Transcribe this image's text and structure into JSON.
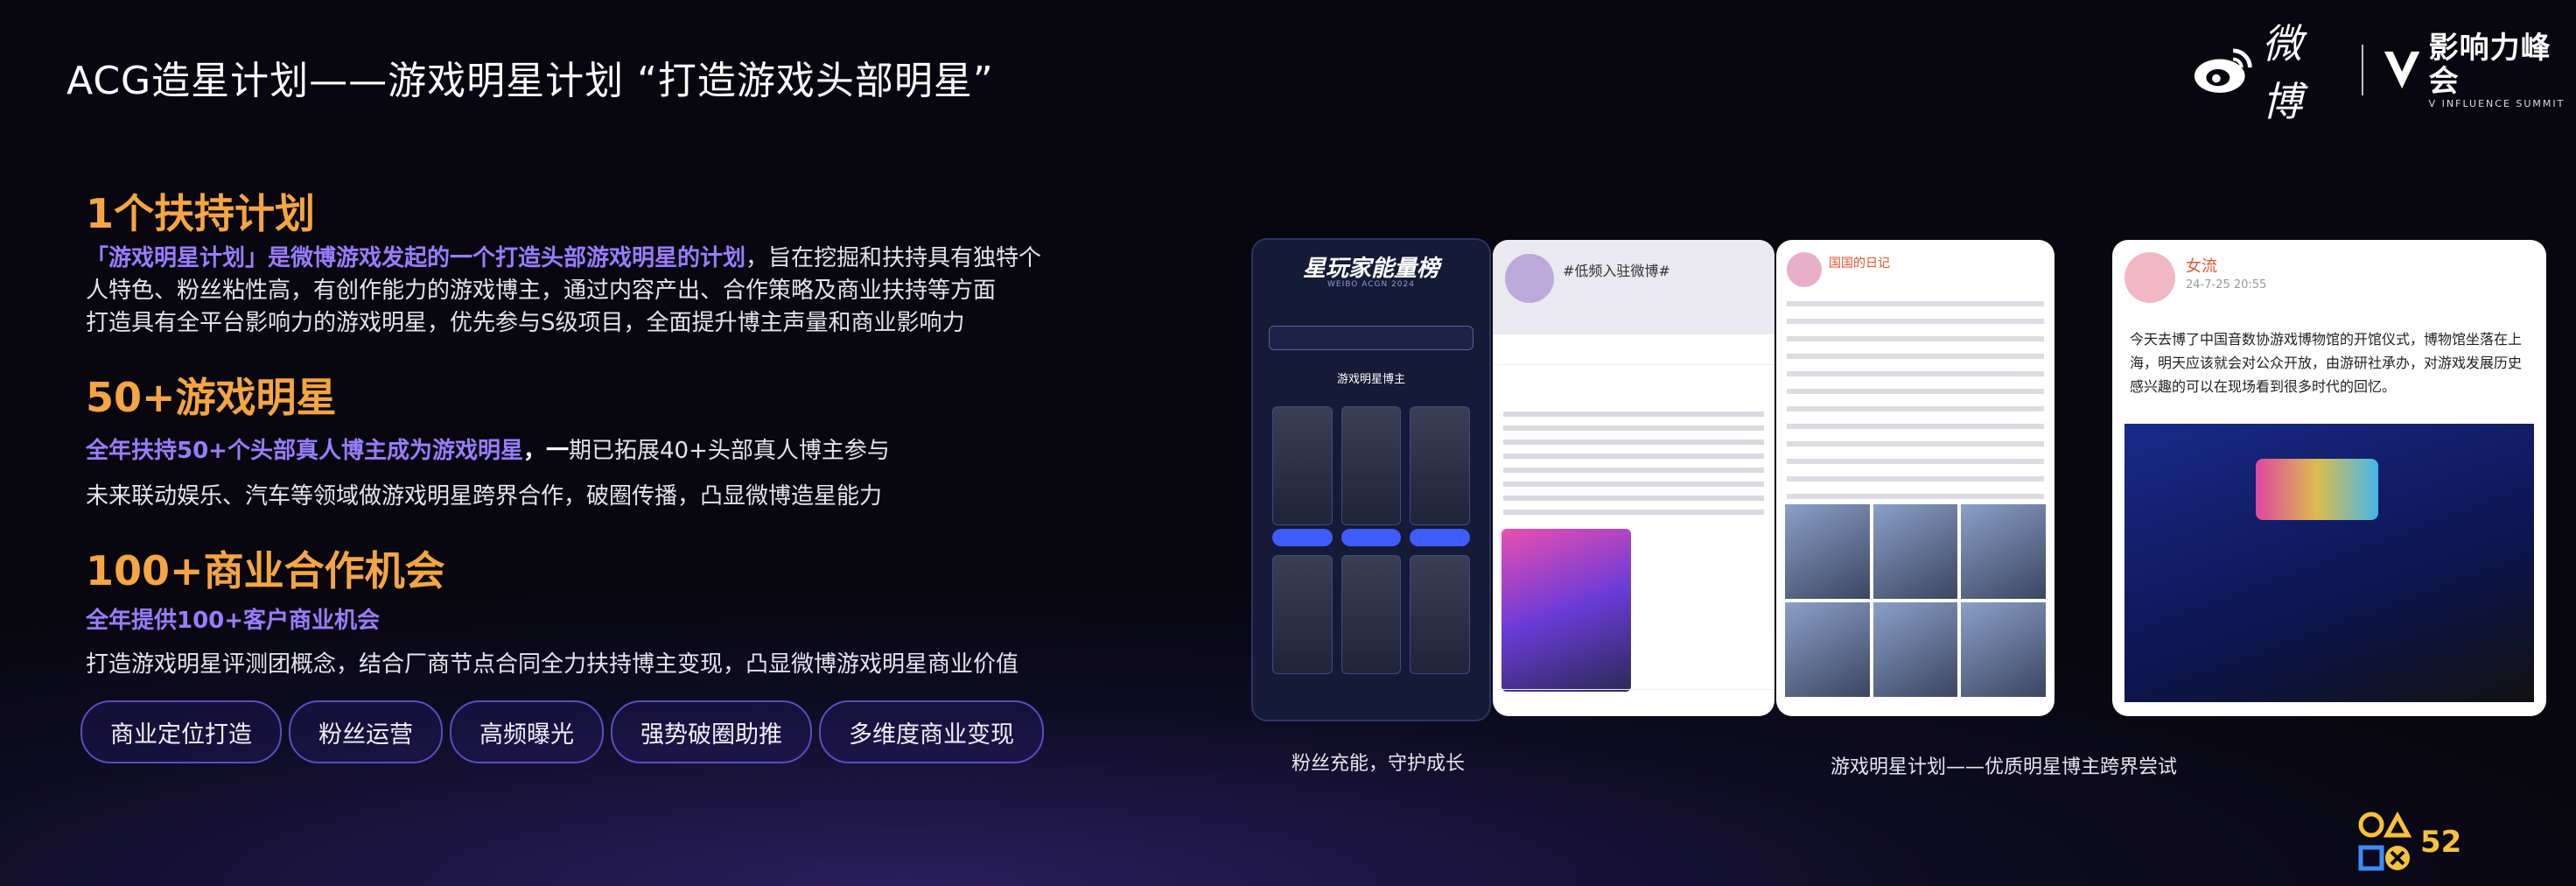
{
  "header": {
    "title": "ACG造星计划——游戏明星计划 “打造游戏头部明星”",
    "logo_text": "微博",
    "summit_cn": "影响力峰会",
    "summit_en": "V INFLUENCE SUMMIT"
  },
  "sections": [
    {
      "heading": "1个扶持计划",
      "lines": [
        {
          "highlight": "「游戏明星计划」是微博游戏发起的一个打造头部游戏明星的计划",
          "rest": "，旨在挖掘和扶持具有独特个"
        },
        {
          "highlight": "",
          "rest": "人特色、粉丝粘性高，有创作能力的游戏博主，通过内容产出、合作策略及商业扶持等方面"
        },
        {
          "highlight": "",
          "rest": "打造具有全平台影响力的游戏明星，优先参与S级项目，全面提升博主声量和商业影响力"
        }
      ]
    },
    {
      "heading": "50+游戏明星",
      "lines": [
        {
          "highlight": "全年扶持50+个头部真人博主成为游戏明星",
          "bold": "，一",
          "rest": "期已拓展40+头部真人博主参与"
        },
        {
          "highlight": "",
          "rest": "未来联动娱乐、汽车等领域做游戏明星跨界合作，破圈传播，凸显微博造星能力"
        }
      ]
    },
    {
      "heading": "100+商业合作机会",
      "lines": [
        {
          "highlight": "全年提供100+客户商业机会",
          "rest": ""
        },
        {
          "highlight": "",
          "rest": "打造游戏明星评测团概念，结合厂商节点合同全力扶持博主变现，凸显微博游戏明星商业价值"
        }
      ]
    }
  ],
  "pills": [
    "商业定位打造",
    "粉丝运营",
    "高频曝光",
    "强势破圈助推",
    "多维度商业变现"
  ],
  "cards": {
    "card1_title": "星玩家能量榜",
    "card1_sub": "WEIBO ACGN 2024",
    "card1_label": "游戏明星博主",
    "card2_topic": "#低频入驻微博#",
    "card3_user": "国国的日记",
    "card4_user": "女流",
    "card4_time": "24-7-25 20:55",
    "card4_text": "今天去博了中国音数协游戏博物馆的开馆仪式，博物馆坐落在上海，明天应该就会对公众开放，由游研社承办，对游戏发展历史感兴趣的可以在现场看到很多时代的回忆。"
  },
  "captions": {
    "left": "粉丝充能，守护成长",
    "right": "游戏明星计划——优质明星博主跨界尝试"
  },
  "watermark": "52",
  "colors": {
    "heading": "#f5a541",
    "highlight": "#9a7cff",
    "pill_border": "#5b4cc4"
  }
}
